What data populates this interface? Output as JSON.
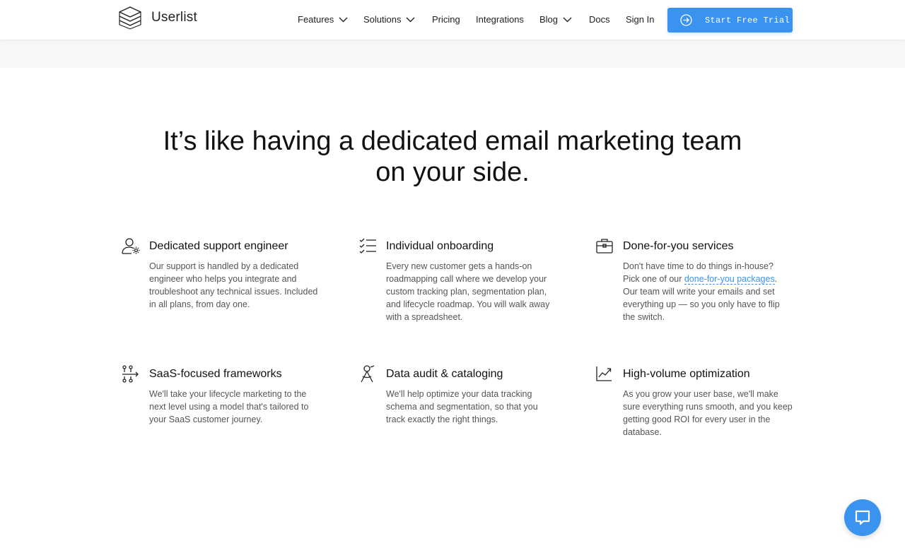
{
  "brand": {
    "name": "Userlist"
  },
  "nav": {
    "items": [
      {
        "label": "Features",
        "has_dropdown": true
      },
      {
        "label": "Solutions",
        "has_dropdown": true
      },
      {
        "label": "Pricing",
        "has_dropdown": false
      },
      {
        "label": "Integrations",
        "has_dropdown": false
      },
      {
        "label": "Blog",
        "has_dropdown": true
      },
      {
        "label": "Docs",
        "has_dropdown": false
      },
      {
        "label": "Sign In",
        "has_dropdown": false
      }
    ],
    "cta_label": "Start Free Trial"
  },
  "hero": {
    "headline_line1": "It’s like having a dedicated email marketing team",
    "headline_line2": "on your side."
  },
  "features": [
    {
      "icon": "user-gear-icon",
      "title": "Dedicated support engineer",
      "description": "Our support is handled by a dedicated engineer who helps you integrate and troubleshoot any technical issues. Included in all plans, from day one."
    },
    {
      "icon": "checklist-icon",
      "title": "Individual onboarding",
      "description": "Every new customer gets a hands-on roadmapping call where we develop your custom tracking plan, segmentation plan, and lifecycle roadmap. You will walk away with a spreadsheet."
    },
    {
      "icon": "briefcase-icon",
      "title": "Done-for-you services",
      "description_before": "Don't have time to do things in-house? Pick one of our ",
      "link_text": "done-for-you packages",
      "description_after": ". Our team will write your emails and set everything up — so you only have to flip the switch."
    },
    {
      "icon": "flow-icon",
      "title": "SaaS-focused frameworks",
      "description": "We'll take your lifecycle marketing to the next level using a model that's tailored to your SaaS customer journey."
    },
    {
      "icon": "person-compass-icon",
      "title": "Data audit & cataloging",
      "description": "We'll help optimize your data tracking schema and segmentation, so that you track exactly the right things."
    },
    {
      "icon": "chart-up-icon",
      "title": "High-volume optimization",
      "description": "As you grow your user base, we'll make sure everything runs smooth, and you keep getting good ROI for every user in the database."
    }
  ],
  "colors": {
    "accent": "#3b93f0",
    "text": "#111111",
    "muted": "#555555",
    "band": "#f7f7f7"
  },
  "chat": {
    "icon": "chat-bubble-icon"
  }
}
